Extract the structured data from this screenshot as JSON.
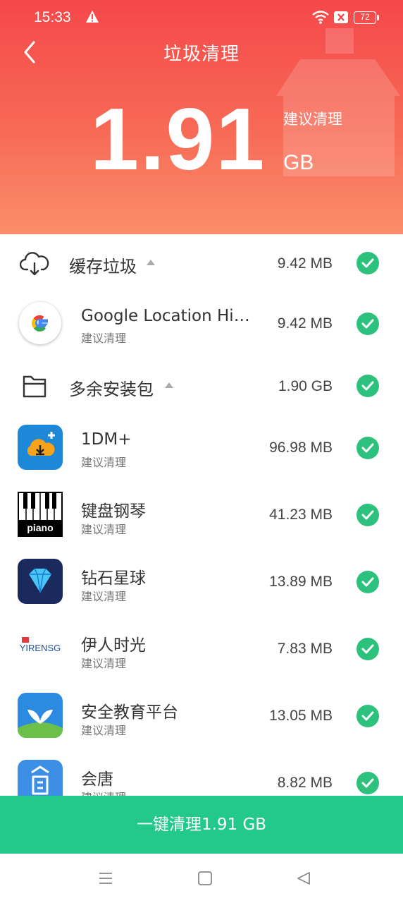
{
  "status_bar": {
    "time": "15:33",
    "battery": "72"
  },
  "header": {
    "title": "垃圾清理",
    "total_size": "1.91",
    "suggest_label": "建议清理",
    "unit": "GB"
  },
  "categories": [
    {
      "label": "缓存垃圾",
      "size": "9.42 MB",
      "icon": "cloud-icon"
    },
    {
      "label": "多余安装包",
      "size": "1.90 GB",
      "icon": "folder-icon"
    }
  ],
  "apps": [
    {
      "name": "Google Location His...",
      "sub": "建议清理",
      "size": "9.42 MB"
    },
    {
      "name": "1DM+",
      "sub": "建议清理",
      "size": "96.98 MB"
    },
    {
      "name": "键盘钢琴",
      "sub": "建议清理",
      "size": "41.23 MB"
    },
    {
      "name": "钻石星球",
      "sub": "建议清理",
      "size": "13.89 MB"
    },
    {
      "name": "伊人时光",
      "sub": "建议清理",
      "size": "7.83 MB"
    },
    {
      "name": "安全教育平台",
      "sub": "建议清理",
      "size": "13.05 MB"
    },
    {
      "name": "会唐",
      "sub": "建议清理",
      "size": "8.82 MB"
    }
  ],
  "app_icon_text": {
    "piano": "piano",
    "yirensg": "YIRENSG"
  },
  "clean_button_label": "一键清理1.91 GB",
  "colors": {
    "header_top": "#f5474a",
    "header_bottom": "#fb8d6c",
    "accent_green": "#22c98a",
    "check_green": "#2dc17e"
  }
}
